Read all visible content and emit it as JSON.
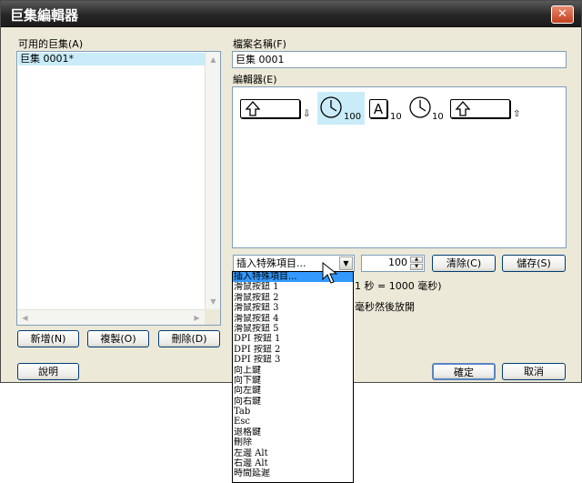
{
  "window": {
    "title": "巨集編輯器",
    "close_glyph": "✕"
  },
  "left": {
    "list_label": "可用的巨集(A)",
    "macros": [
      "巨集 0001*"
    ],
    "add_button": "新增(N)",
    "copy_button": "複製(O)",
    "delete_button": "刪除(D)"
  },
  "right": {
    "filename_label": "檔案名稱(F)",
    "filename_value": "巨集 0001",
    "editor_label": "編輯器(E)",
    "sequence": [
      {
        "type": "key-down",
        "icon": "up-arrow-icon",
        "badge": "⇩"
      },
      {
        "type": "delay",
        "icon": "clock-icon",
        "value": "100",
        "selected": true
      },
      {
        "type": "key",
        "label": "A",
        "value": "10"
      },
      {
        "type": "delay",
        "icon": "clock-icon",
        "value": "10"
      },
      {
        "type": "key-up",
        "icon": "up-arrow-icon",
        "badge": "⇧"
      }
    ],
    "insert_combo": "插入特殊項目...",
    "delay_value": "100",
    "clear_button": "清除(C)",
    "save_button": "儲存(S)",
    "hint_text": "1 秒 = 1000 毫秒)",
    "hint_text2": "毫秒然後放開"
  },
  "footer": {
    "help_button": "說明",
    "ok_button": "確定",
    "cancel_button": "取消"
  },
  "dropdown_items": [
    "插入特殊項目...",
    "滑鼠按鈕 1",
    "滑鼠按鈕 2",
    "滑鼠按鈕 3",
    "滑鼠按鈕 4",
    "滑鼠按鈕 5",
    "DPI 按鈕 1",
    "DPI 按鈕 2",
    "DPI 按鈕 3",
    "向上鍵",
    "向下鍵",
    "向左鍵",
    "向右鍵",
    "Tab",
    "Esc",
    "退格鍵",
    "刪除",
    "左邊 Alt",
    "右邊 Alt",
    "時間延遲"
  ],
  "colors": {
    "selection": "#c9ecf8",
    "dropdown_highlight": "#3399ff",
    "titlebar": "#262626"
  }
}
